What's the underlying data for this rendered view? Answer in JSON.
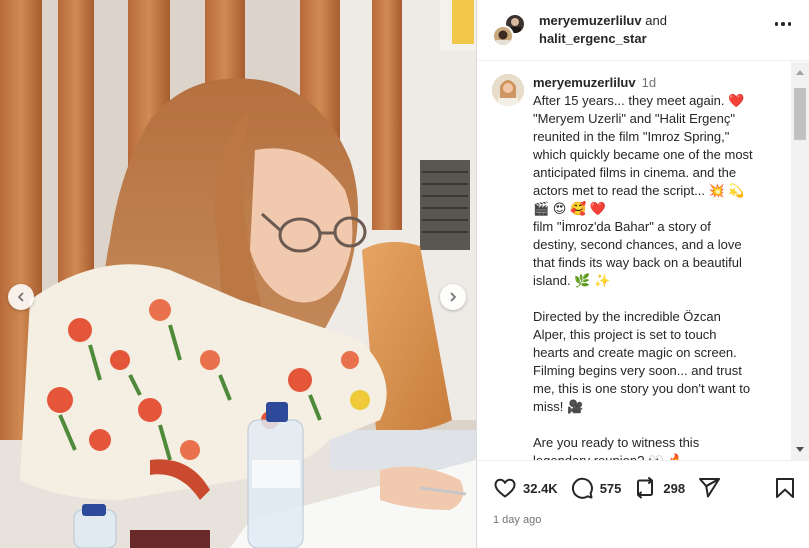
{
  "header": {
    "user1": "meryemuzerliluv",
    "connector": "and",
    "user2": "halit_ergenc_star"
  },
  "caption": {
    "username": "meryemuzerliluv",
    "time": "1d",
    "lines": [
      "After 15 years... they meet again. ❤️",
      "\"Meryem Uzerli\" and \"Halit Ergenç\"",
      "reunited in the film \"Imroz Spring,\"",
      "which quickly became one of the most",
      "anticipated films in cinema. and the",
      "actors met to read the script... 💥 💫",
      "🎬 😍 🥰 ❤️",
      "film \"İmroz'da Bahar\" a story of",
      "destiny, second chances, and a love",
      "that finds its way back on a beautiful",
      "island. 🌿 ✨",
      "",
      "Directed by the incredible Özcan",
      "Alper, this project is set to touch",
      "hearts and create magic on screen.",
      "Filming begins very soon... and trust",
      "me, this is one story you don't want to",
      "miss! 🎥",
      "",
      "Are you ready to witness this",
      "legendary reunion? 👀 🔥"
    ]
  },
  "stats": {
    "likes": "32.4K",
    "comments": "575",
    "reposts": "298"
  },
  "timestamp": "1 day ago",
  "icons": {
    "like": "heart-icon",
    "comment": "comment-icon",
    "repost": "repost-icon",
    "share": "share-icon",
    "save": "bookmark-icon",
    "prev": "chevron-left-icon",
    "next": "chevron-right-icon",
    "more": "more-icon"
  }
}
